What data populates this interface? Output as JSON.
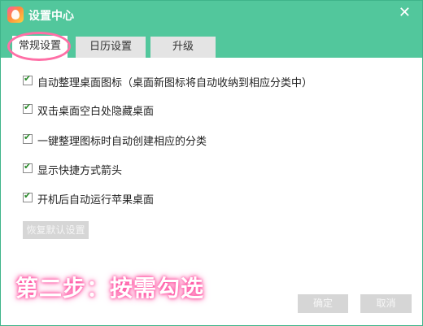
{
  "window": {
    "title": "设置中心",
    "close_glyph": "✕"
  },
  "tabs": [
    {
      "label": "常规设置",
      "active": true
    },
    {
      "label": "日历设置",
      "active": false
    },
    {
      "label": "升级",
      "active": false
    }
  ],
  "options": [
    {
      "label": "自动整理桌面图标（桌面新图标将自动收纳到相应分类中）",
      "checked": true
    },
    {
      "label": "双击桌面空白处隐藏桌面",
      "checked": true
    },
    {
      "label": "一键整理图标时自动创建相应的分类",
      "checked": true
    },
    {
      "label": "显示快捷方式箭头",
      "checked": true
    },
    {
      "label": "开机后自动运行苹果桌面",
      "checked": true
    }
  ],
  "restore_label": "恢复默认设置",
  "annotation": "第二步：按需勾选",
  "footer": {
    "ok_label": "确定",
    "cancel_label": "取消"
  },
  "colors": {
    "titlebar": "#52c79c",
    "highlight": "#ff6fa6",
    "button_disabled": "#d6d6d6"
  }
}
